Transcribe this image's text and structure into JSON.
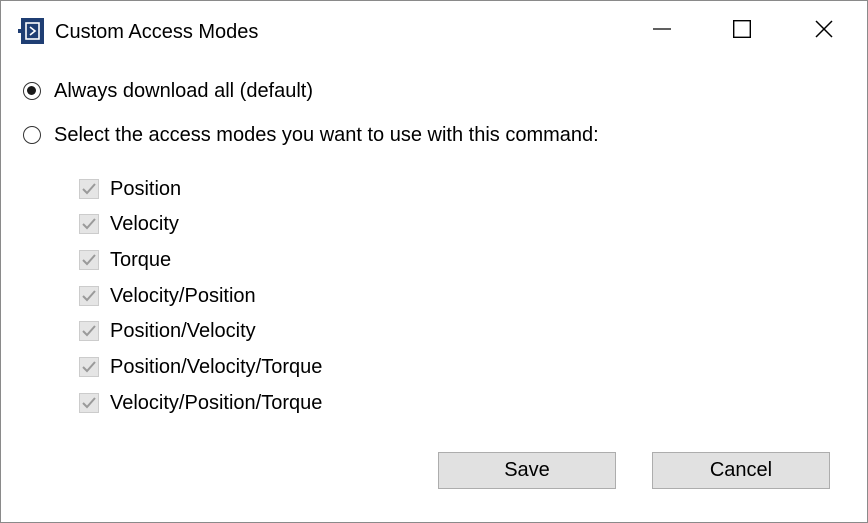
{
  "window": {
    "title": "Custom Access Modes",
    "icon": "app-window-icon",
    "controls": {
      "minimize_icon": "minimize-icon",
      "maximize_icon": "maximize-icon",
      "close_icon": "close-icon"
    }
  },
  "options": {
    "always_download": {
      "label": "Always download all (default)",
      "selected": true
    },
    "select_modes": {
      "label": "Select the access modes you want to use with this command:",
      "selected": false
    }
  },
  "access_modes": [
    {
      "label": "Position",
      "checked": true,
      "enabled": false
    },
    {
      "label": "Velocity",
      "checked": true,
      "enabled": false
    },
    {
      "label": "Torque",
      "checked": true,
      "enabled": false
    },
    {
      "label": "Velocity/Position",
      "checked": true,
      "enabled": false
    },
    {
      "label": "Position/Velocity",
      "checked": true,
      "enabled": false
    },
    {
      "label": "Position/Velocity/Torque",
      "checked": true,
      "enabled": false
    },
    {
      "label": "Velocity/Position/Torque",
      "checked": true,
      "enabled": false
    }
  ],
  "buttons": {
    "save_label": "Save",
    "cancel_label": "Cancel"
  },
  "colors": {
    "icon_blue": "#1f3e73",
    "checkbox_disabled_bg": "#e5e5e5",
    "checkmark_disabled": "#9a9a9a",
    "button_bg": "#e1e1e1"
  }
}
